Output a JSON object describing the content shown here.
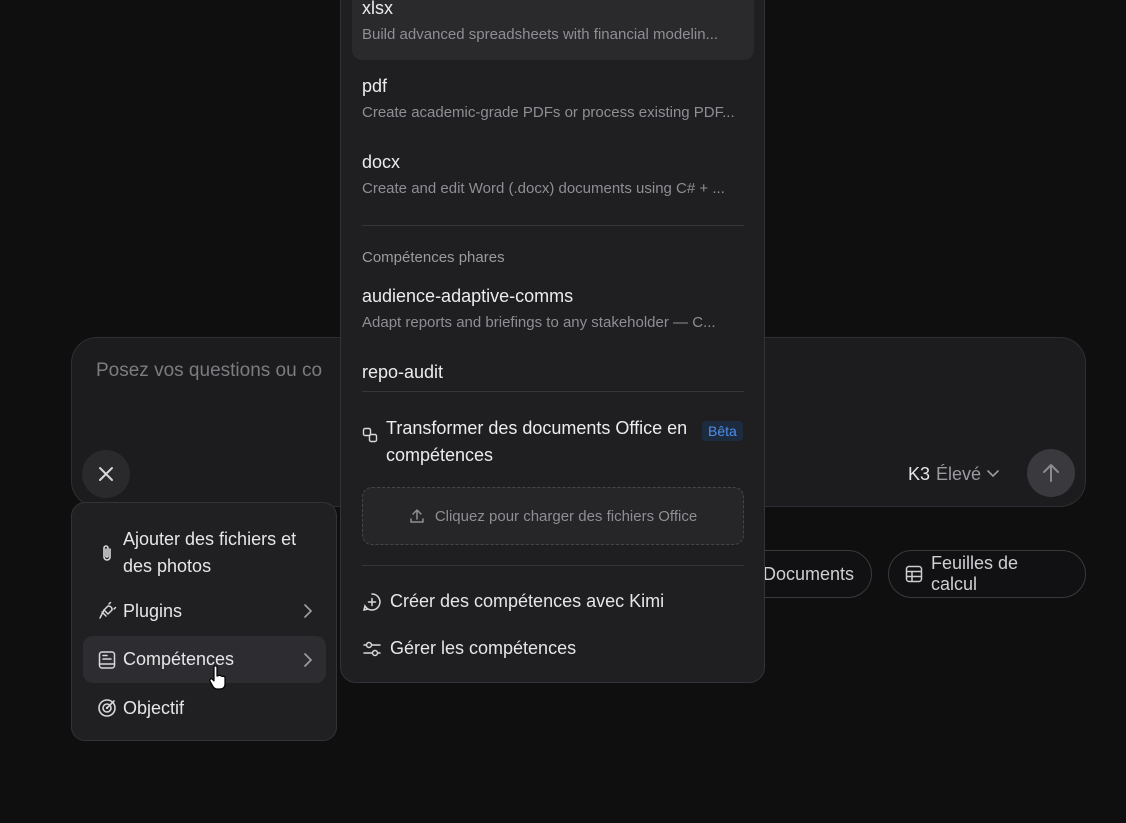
{
  "composer": {
    "placeholder": "Posez vos questions ou co",
    "model_name": "K3",
    "model_mode": "Élevé"
  },
  "chips": {
    "documents": "Documents",
    "spreadsheets": "Feuilles de calcul"
  },
  "left_menu": {
    "items": [
      {
        "label_line1": "Ajouter des fichiers et",
        "label_line2": "des photos",
        "icon": "paperclip-icon"
      },
      {
        "label": "Plugins",
        "icon": "plug-icon"
      },
      {
        "label": "Compétences",
        "icon": "skills-icon"
      },
      {
        "label": "Objectif",
        "icon": "target-icon"
      }
    ]
  },
  "skills_menu": {
    "items": [
      {
        "title": "xlsx",
        "desc": "Build advanced spreadsheets with financial modelin..."
      },
      {
        "title": "pdf",
        "desc": "Create academic-grade PDFs or process existing PDF..."
      },
      {
        "title": "docx",
        "desc": "Create and edit Word (.docx) documents using C# + ..."
      }
    ],
    "featured_label": "Compétences phares",
    "featured": [
      {
        "title": "audience-adaptive-comms",
        "desc": "Adapt reports and briefings to any stakeholder — C..."
      },
      {
        "title": "repo-audit"
      }
    ],
    "transform_line1": "Transformer des documents Office en",
    "transform_line2": "compétences",
    "beta": "Bêta",
    "upload_label": "Cliquez pour charger des fichiers Office",
    "create_label": "Créer des compétences avec Kimi",
    "manage_label": "Gérer les compétences"
  },
  "colors": {
    "background": "#0f0f10",
    "panel": "#1f1f22",
    "beta_text": "#4f8fe8"
  }
}
